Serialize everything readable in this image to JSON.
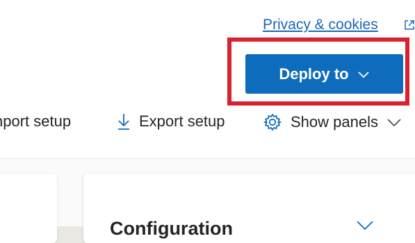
{
  "header": {
    "privacy_link": "Privacy & cookies",
    "external_icon": "external-link-icon"
  },
  "deploy": {
    "label": "Deploy to",
    "icon": "chevron-down-icon",
    "accent": "#0f6cbd",
    "highlight_color": "#d7232f"
  },
  "toolbar": {
    "import_label": "nport setup",
    "export_label": "Export setup",
    "export_icon": "download-arrow-icon",
    "panels_label": "Show panels",
    "panels_icon": "gear-icon",
    "panels_chevron": "chevron-down-icon"
  },
  "panel": {
    "title": "Configuration",
    "chevron": "chevron-down-icon"
  }
}
